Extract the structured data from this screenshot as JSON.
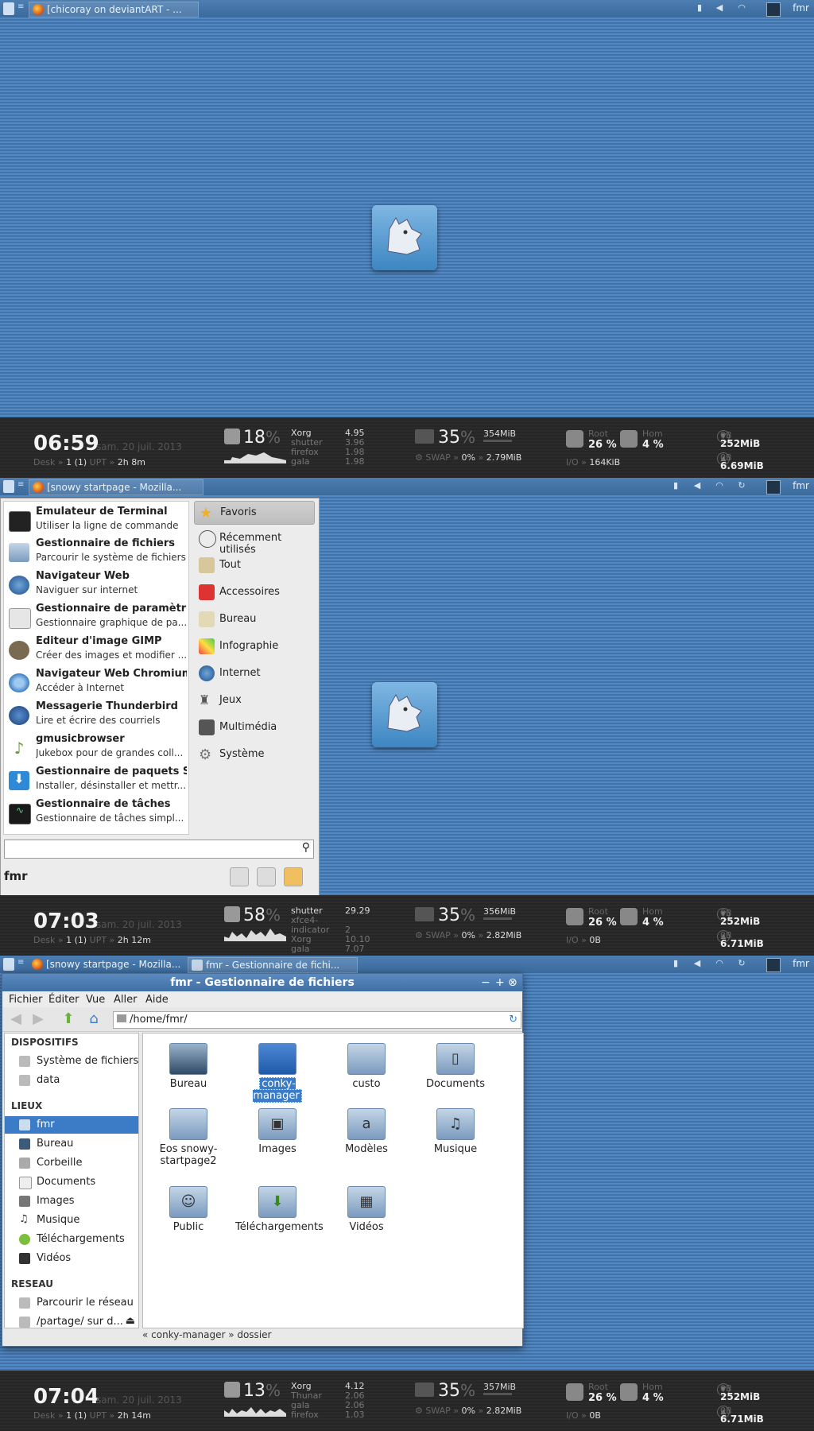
{
  "screens": [
    {
      "top": {
        "tasks": [
          {
            "label": "[chicoray on deviantART - ..."
          }
        ],
        "user": "fmr"
      },
      "panel": {
        "time": "06:59",
        "date": "sam. 20 juil. 2013",
        "desk_label": "Desk »",
        "desk_value": "1 (1)",
        "upt_label": "UPT »",
        "uptime": "2h 8m",
        "cpu": "18",
        "procs": [
          [
            "Xorg",
            "4.95"
          ],
          [
            "shutter",
            "3.96"
          ],
          [
            "firefox",
            "1.98"
          ],
          [
            "gala",
            "1.98"
          ]
        ],
        "mem": "35",
        "mem_used": "354MiB",
        "swap_pct": "0%",
        "swap_used": "2.79MiB",
        "io": "164KiB",
        "root_pct": "26 %",
        "home_pct": "4 %",
        "net_down": "252MiB",
        "net_up": "6.69MiB"
      }
    },
    {
      "top": {
        "tasks": [
          {
            "label": "[snowy startpage - Mozilla..."
          }
        ],
        "user": "fmr"
      },
      "panel": {
        "time": "07:03",
        "date": "sam. 20 juil. 2013",
        "desk_label": "Desk »",
        "desk_value": "1 (1)",
        "upt_label": "UPT »",
        "uptime": "2h 12m",
        "cpu": "58",
        "procs": [
          [
            "shutter",
            "29.29"
          ],
          [
            "xfce4-indicator",
            "2"
          ],
          [
            "Xorg",
            "10.10"
          ],
          [
            "gala",
            "7.07"
          ]
        ],
        "mem": "35",
        "mem_used": "356MiB",
        "swap_pct": "0%",
        "swap_used": "2.82MiB",
        "io": "0B",
        "root_pct": "26 %",
        "home_pct": "4 %",
        "net_down": "252MiB",
        "net_up": "6.71MiB"
      }
    },
    {
      "top": {
        "tasks": [
          {
            "label": "[snowy startpage - Mozilla..."
          },
          {
            "label": "fmr - Gestionnaire de fichi..."
          }
        ],
        "user": "fmr"
      },
      "panel": {
        "time": "07:04",
        "date": "sam. 20 juil. 2013",
        "desk_label": "Desk »",
        "desk_value": "1 (1)",
        "upt_label": "UPT »",
        "uptime": "2h 14m",
        "cpu": "13",
        "procs": [
          [
            "Xorg",
            "4.12"
          ],
          [
            "Thunar",
            "2.06"
          ],
          [
            "gala",
            "2.06"
          ],
          [
            "firefox",
            "1.03"
          ]
        ],
        "mem": "35",
        "mem_used": "357MiB",
        "swap_pct": "0%",
        "swap_used": "2.82MiB",
        "io": "0B",
        "root_pct": "26 %",
        "home_pct": "4 %",
        "net_down": "252MiB",
        "net_up": "6.71MiB"
      }
    }
  ],
  "panel_labels": {
    "pct_sign": "%",
    "swap": "SWAP »",
    "io": "I/O »",
    "root": "Root",
    "home": "Hom",
    "zero": "0B"
  },
  "menu": {
    "favorites": [
      {
        "title": "Émulateur de Terminal",
        "sub": "Utiliser la ligne de commande"
      },
      {
        "title": "Gestionnaire de fichiers",
        "sub": "Parcourir le système de fichiers"
      },
      {
        "title": "Navigateur Web",
        "sub": "Naviguer sur internet"
      },
      {
        "title": "Gestionnaire de paramètres",
        "sub": "Gestionnaire graphique de pa..."
      },
      {
        "title": "Éditeur d'image GIMP",
        "sub": "Créer des images et modifier ..."
      },
      {
        "title": "Navigateur Web Chromium",
        "sub": "Accéder à Internet"
      },
      {
        "title": "Messagerie Thunderbird",
        "sub": "Lire et écrire des courriels"
      },
      {
        "title": "gmusicbrowser",
        "sub": "Jukebox pour de grandes coll..."
      },
      {
        "title": "Gestionnaire de paquets Sy...",
        "sub": "Installer, désinstaller et mettr..."
      },
      {
        "title": "Gestionnaire de tâches",
        "sub": "Gestionnaire de tâches simpl..."
      }
    ],
    "categories": [
      "Favoris",
      "Récemment utilisés",
      "Tout",
      "Accessoires",
      "Bureau",
      "Infographie",
      "Internet",
      "Jeux",
      "Multimédia",
      "Système"
    ],
    "user": "fmr",
    "search_value": ""
  },
  "filemanager": {
    "title": "fmr - Gestionnaire de fichiers",
    "menu": [
      "Fichier",
      "Éditer",
      "Vue",
      "Aller",
      "Aide"
    ],
    "path": "/home/fmr/",
    "sections": {
      "devices": "DISPOSITIFS",
      "places": "LIEUX",
      "network": "RESEAU"
    },
    "devices": [
      "Système de fichiers",
      "data"
    ],
    "places": [
      "fmr",
      "Bureau",
      "Corbeille",
      "Documents",
      "Images",
      "Musique",
      "Téléchargements",
      "Vidéos"
    ],
    "network": [
      "Parcourir le réseau",
      "/partage/ sur d..."
    ],
    "items": [
      "Bureau",
      "conky-manager",
      "custo",
      "Documents",
      "Eos snowy-startpage2",
      "Images",
      "Modèles",
      "Musique",
      "Public",
      "Téléchargements",
      "Vidéos"
    ],
    "statusbar": "« conky-manager » dossier"
  }
}
